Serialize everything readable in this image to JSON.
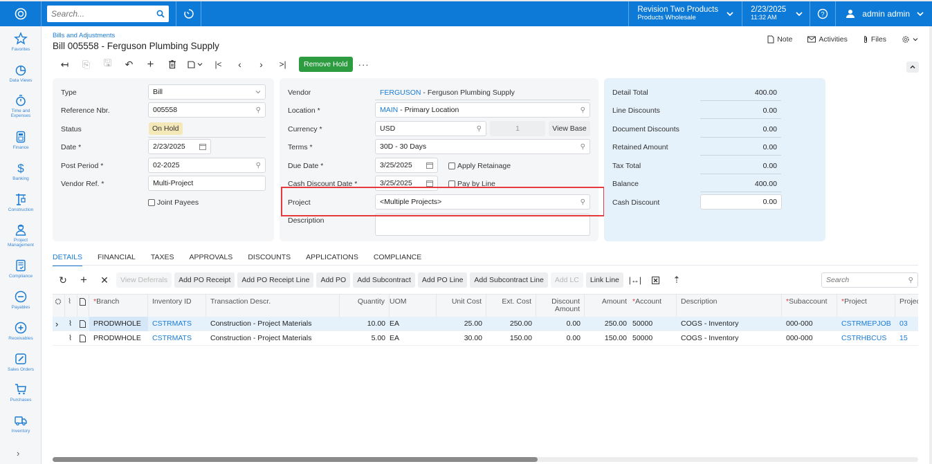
{
  "topbar": {
    "search_placeholder": "Search...",
    "tenant_name": "Revision Two Products",
    "tenant_branch": "Products Wholesale",
    "date": "2/23/2025",
    "time": "11:32 AM",
    "user": "admin admin"
  },
  "sidebar": {
    "items": [
      {
        "label": "Favorites",
        "icon": "star-icon"
      },
      {
        "label": "Data Views",
        "icon": "pie-chart-icon"
      },
      {
        "label": "Time and Expenses",
        "icon": "stopwatch-icon"
      },
      {
        "label": "Finance",
        "icon": "calculator-icon"
      },
      {
        "label": "Banking",
        "icon": "dollar-icon"
      },
      {
        "label": "Construction",
        "icon": "crane-icon"
      },
      {
        "label": "Project Management",
        "icon": "worker-icon"
      },
      {
        "label": "Compliance",
        "icon": "checklist-icon"
      },
      {
        "label": "Payables",
        "icon": "minus-circle-icon"
      },
      {
        "label": "Receivables",
        "icon": "plus-circle-icon"
      },
      {
        "label": "Sales Orders",
        "icon": "pencil-icon"
      },
      {
        "label": "Purchases",
        "icon": "cart-icon"
      },
      {
        "label": "Inventory",
        "icon": "truck-icon"
      }
    ]
  },
  "header": {
    "breadcrumb": "Bills and Adjustments",
    "title": "Bill 005558 - Ferguson Plumbing Supply",
    "note": "Note",
    "activities": "Activities",
    "files": "Files",
    "remove_hold": "Remove Hold",
    "more": "···"
  },
  "summary_left": {
    "type_label": "Type",
    "type_value": "Bill",
    "ref_label": "Reference Nbr.",
    "ref_value": "005558",
    "status_label": "Status",
    "status_value": "On Hold",
    "date_label": "Date *",
    "date_value": "2/23/2025",
    "period_label": "Post Period *",
    "period_value": "02-2025",
    "vendor_ref_label": "Vendor Ref. *",
    "vendor_ref_value": "Multi-Project",
    "joint_payees": "Joint Payees"
  },
  "summary_mid": {
    "vendor_label": "Vendor",
    "vendor_code": "FERGUSON",
    "vendor_name": " - Ferguson Plumbing Supply",
    "location_label": "Location *",
    "location_code": "MAIN",
    "location_name": " - Primary Location",
    "currency_label": "Currency *",
    "currency_value": "USD",
    "rate_value": "1",
    "view_base": "View Base",
    "terms_label": "Terms *",
    "terms_value": "30D - 30 Days",
    "due_label": "Due Date *",
    "due_value": "3/25/2025",
    "apply_retainage": "Apply Retainage",
    "cash_disc_label": "Cash Discount Date *",
    "cash_disc_value": "3/25/2025",
    "pay_by_line": "Pay by Line",
    "project_label": "Project",
    "project_value": "<Multiple Projects>",
    "description_label": "Description",
    "description_value": ""
  },
  "totals": [
    {
      "label": "Detail Total",
      "value": "400.00"
    },
    {
      "label": "Line Discounts",
      "value": "0.00"
    },
    {
      "label": "Document Discounts",
      "value": "0.00"
    },
    {
      "label": "Retained Amount",
      "value": "0.00"
    },
    {
      "label": "Tax Total",
      "value": "0.00"
    },
    {
      "label": "Balance",
      "value": "400.00"
    },
    {
      "label": "Cash Discount",
      "value": "0.00"
    }
  ],
  "tabs": [
    "DETAILS",
    "FINANCIAL",
    "TAXES",
    "APPROVALS",
    "DISCOUNTS",
    "APPLICATIONS",
    "COMPLIANCE"
  ],
  "grid_toolbar": {
    "buttons": [
      "View Deferrals",
      "Add PO Receipt",
      "Add PO Receipt Line",
      "Add PO",
      "Add Subcontract",
      "Add PO Line",
      "Add Subcontract Line",
      "Add LC",
      "Link Line"
    ],
    "search_placeholder": "Search"
  },
  "grid": {
    "columns": [
      "Branch",
      "Inventory ID",
      "Transaction Descr.",
      "Quantity",
      "UOM",
      "Unit Cost",
      "Ext. Cost",
      "Discount Amount",
      "Amount",
      "Account",
      "Description",
      "Subaccount",
      "Project",
      "Projec"
    ],
    "rows": [
      {
        "branch": "PRODWHOLE",
        "inventory": "CSTRMATS",
        "descr": "Construction - Project Materials",
        "qty": "10.00",
        "uom": "EA",
        "unit_cost": "25.00",
        "ext_cost": "250.00",
        "discount": "0.00",
        "amount": "250.00",
        "account": "50000",
        "description": "COGS - Inventory",
        "subaccount": "000-000",
        "project": "CSTRMEPJOB",
        "task": "03"
      },
      {
        "branch": "PRODWHOLE",
        "inventory": "CSTRMATS",
        "descr": "Construction - Project Materials",
        "qty": "5.00",
        "uom": "EA",
        "unit_cost": "30.00",
        "ext_cost": "150.00",
        "discount": "0.00",
        "amount": "150.00",
        "account": "50000",
        "description": "COGS - Inventory",
        "subaccount": "000-000",
        "project": "CSTRHBCUS",
        "task": "15"
      }
    ]
  },
  "scroll": {
    "horizontal_fraction": 0.56
  }
}
